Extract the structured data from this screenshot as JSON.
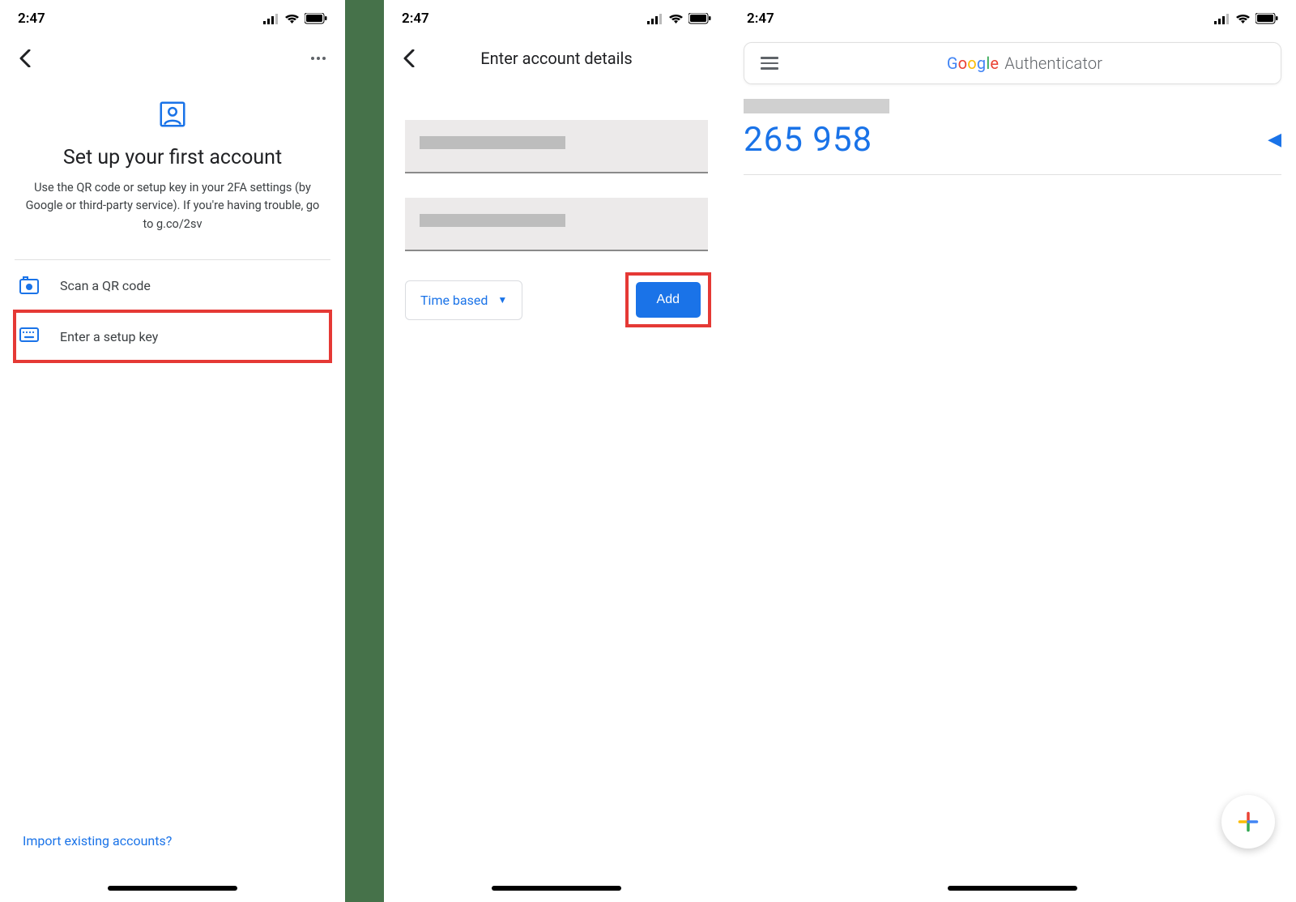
{
  "status": {
    "time": "2:47"
  },
  "screen1": {
    "heading": "Set up your first account",
    "description": "Use the QR code or setup key in your 2FA settings (by Google or third-party service). If you're having trouble, go to g.co/2sv",
    "option_scan": "Scan a QR code",
    "option_key": "Enter a setup key",
    "import_link": "Import existing accounts?"
  },
  "screen2": {
    "title": "Enter account details",
    "type_label": "Time based",
    "add_label": "Add"
  },
  "screen3": {
    "brand_g1": "G",
    "brand_o1": "o",
    "brand_o2": "o",
    "brand_g2": "g",
    "brand_l": "l",
    "brand_e": "e",
    "brand_suffix": " Authenticator",
    "code": "265 958"
  }
}
